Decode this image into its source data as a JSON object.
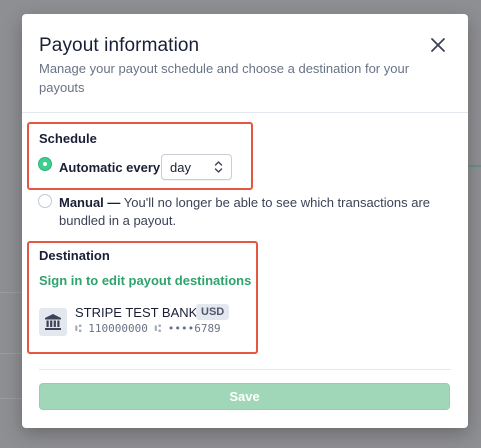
{
  "modal": {
    "title": "Payout information",
    "subtitle": "Manage your payout schedule and choose a destination for your payouts"
  },
  "schedule": {
    "label": "Schedule",
    "automatic_label": "Automatic every",
    "interval_value": "day",
    "manual_label": "Manual —",
    "manual_description": " You'll no longer be able to see which transactions are bundled in a payout.",
    "selected": "automatic"
  },
  "destination": {
    "label": "Destination",
    "edit_link": "Sign in to edit payout destinations",
    "bank_name": "STRIPE TEST BANK",
    "currency": "USD",
    "routing_number": "110000000",
    "account_masked": "••••6789"
  },
  "footer": {
    "save_label": "Save"
  },
  "colors": {
    "accent_green": "#3ecf8e",
    "link_green": "#2ea36c",
    "highlight_red": "#e5573f",
    "save_disabled": "#9fd7b8"
  },
  "icons": {
    "close": "close-icon",
    "bank": "bank-icon",
    "chevron": "chevron-up-down-icon",
    "routing": "routing-symbol-icon"
  }
}
